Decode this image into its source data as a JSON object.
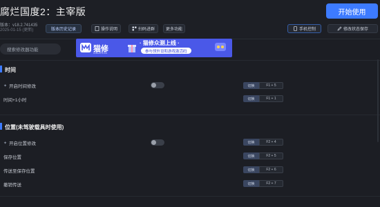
{
  "app": {
    "title": "腐烂国度2：主宰版",
    "version": "版本：v18.2.741435",
    "version_sub": "2025-01-15 (更新)"
  },
  "toolbar": {
    "history": "版本历史记录",
    "help": "操作说明",
    "scan": "扫码进群",
    "more": "更多功能",
    "start": "开始使用",
    "phone": "手机控制",
    "save": "修改状态保存"
  },
  "search": {
    "placeholder": "搜索修改器功能"
  },
  "banner": {
    "brand": "猫修",
    "brand_sub": "CHEATS.CN",
    "headline": "· 猫修众测上线 ·",
    "subline": "参与领外设和游戏激活码"
  },
  "sections": [
    {
      "title": "时间",
      "rows": [
        {
          "label": "开启时间修改",
          "toggle": true,
          "key_btn": "切换",
          "key": "F1 + 5"
        },
        {
          "label": "时间+1小时",
          "toggle": false,
          "key_btn": "切换",
          "key": "F1 + 1"
        }
      ]
    },
    {
      "title": "位置(未驾驶载具时使用)",
      "rows": [
        {
          "label": "开启位置修改",
          "toggle": true,
          "key_btn": "切换",
          "key": "F2 + 4"
        },
        {
          "label": "保存位置",
          "toggle": false,
          "key_btn": "切换",
          "key": "F2 + 5"
        },
        {
          "label": "传送至保存位置",
          "toggle": false,
          "key_btn": "切换",
          "key": "F2 + 6"
        },
        {
          "label": "撤销传送",
          "toggle": false,
          "key_btn": "切换",
          "key": "F2 + 7"
        }
      ]
    }
  ],
  "colors": {
    "accent": "#3d7bff",
    "background": "#1c1e24",
    "banner": "#4a58e8"
  }
}
